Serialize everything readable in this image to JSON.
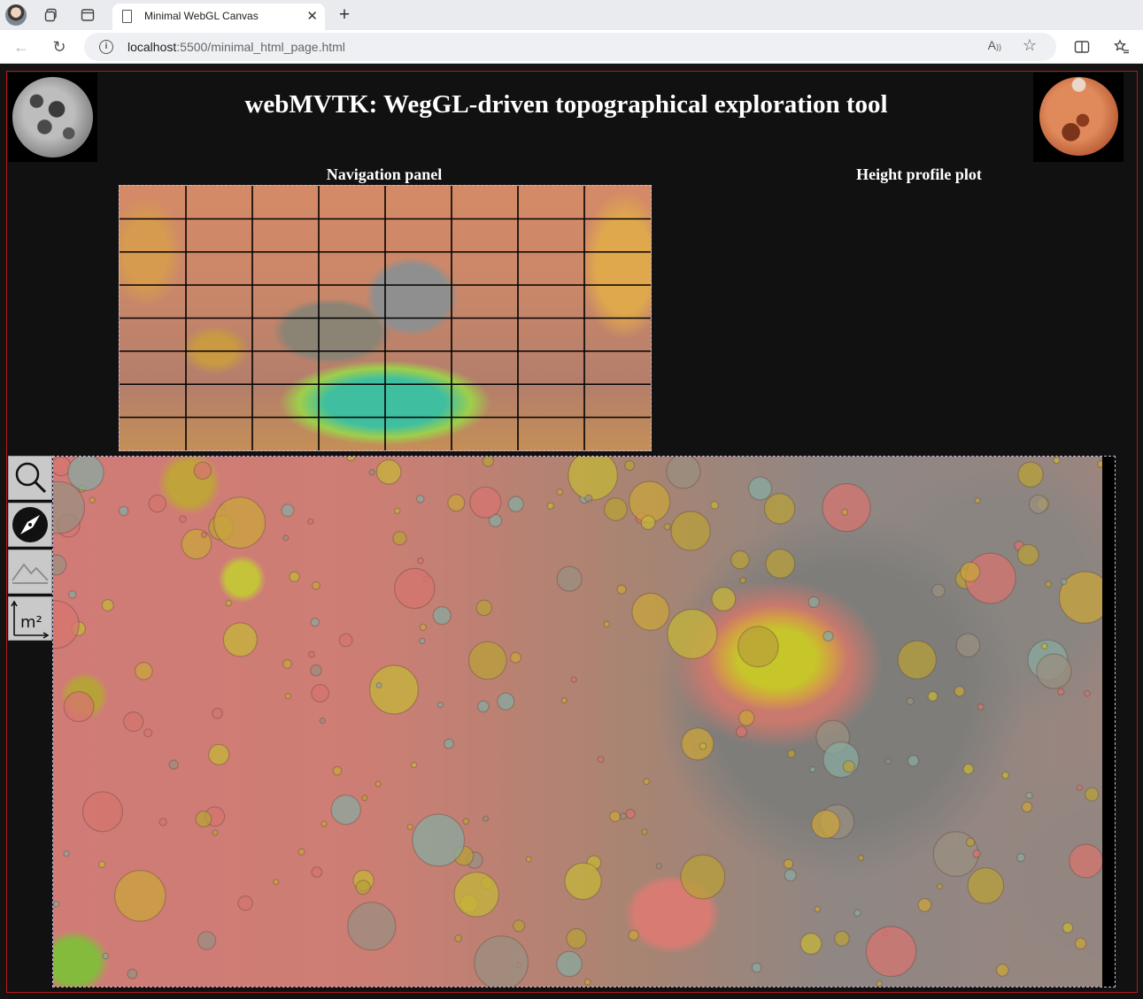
{
  "browser": {
    "tab_title": "Minimal WebGL Canvas",
    "url_host": "localhost",
    "url_path": ":5500/minimal_html_page.html"
  },
  "icons": {
    "back": "arrow-left-icon",
    "reload": "reload-icon",
    "info": "info-icon",
    "read_aloud": "read-aloud-icon",
    "favorite": "star-icon",
    "split": "split-screen-icon",
    "favorites_bar": "favorites-icon"
  },
  "page": {
    "title": "webMVTK: WegGL-driven topographical exploration tool",
    "nav_panel_title": "Navigation panel",
    "height_plot_title": "Height profile plot"
  },
  "tools": [
    {
      "name": "zoom-tool",
      "icon": "magnifier-icon"
    },
    {
      "name": "navigate-tool",
      "icon": "compass-icon"
    },
    {
      "name": "height-profile-tool",
      "icon": "mountain-icon"
    },
    {
      "name": "area-measure-tool",
      "icon": "square-meter-icon",
      "label": "m²"
    }
  ],
  "nav_grid": {
    "columns": 8,
    "rows": 8
  },
  "colors": {
    "frame_border": "#b51818",
    "panel_border": "#c9b7d8",
    "page_background": "#111111"
  }
}
